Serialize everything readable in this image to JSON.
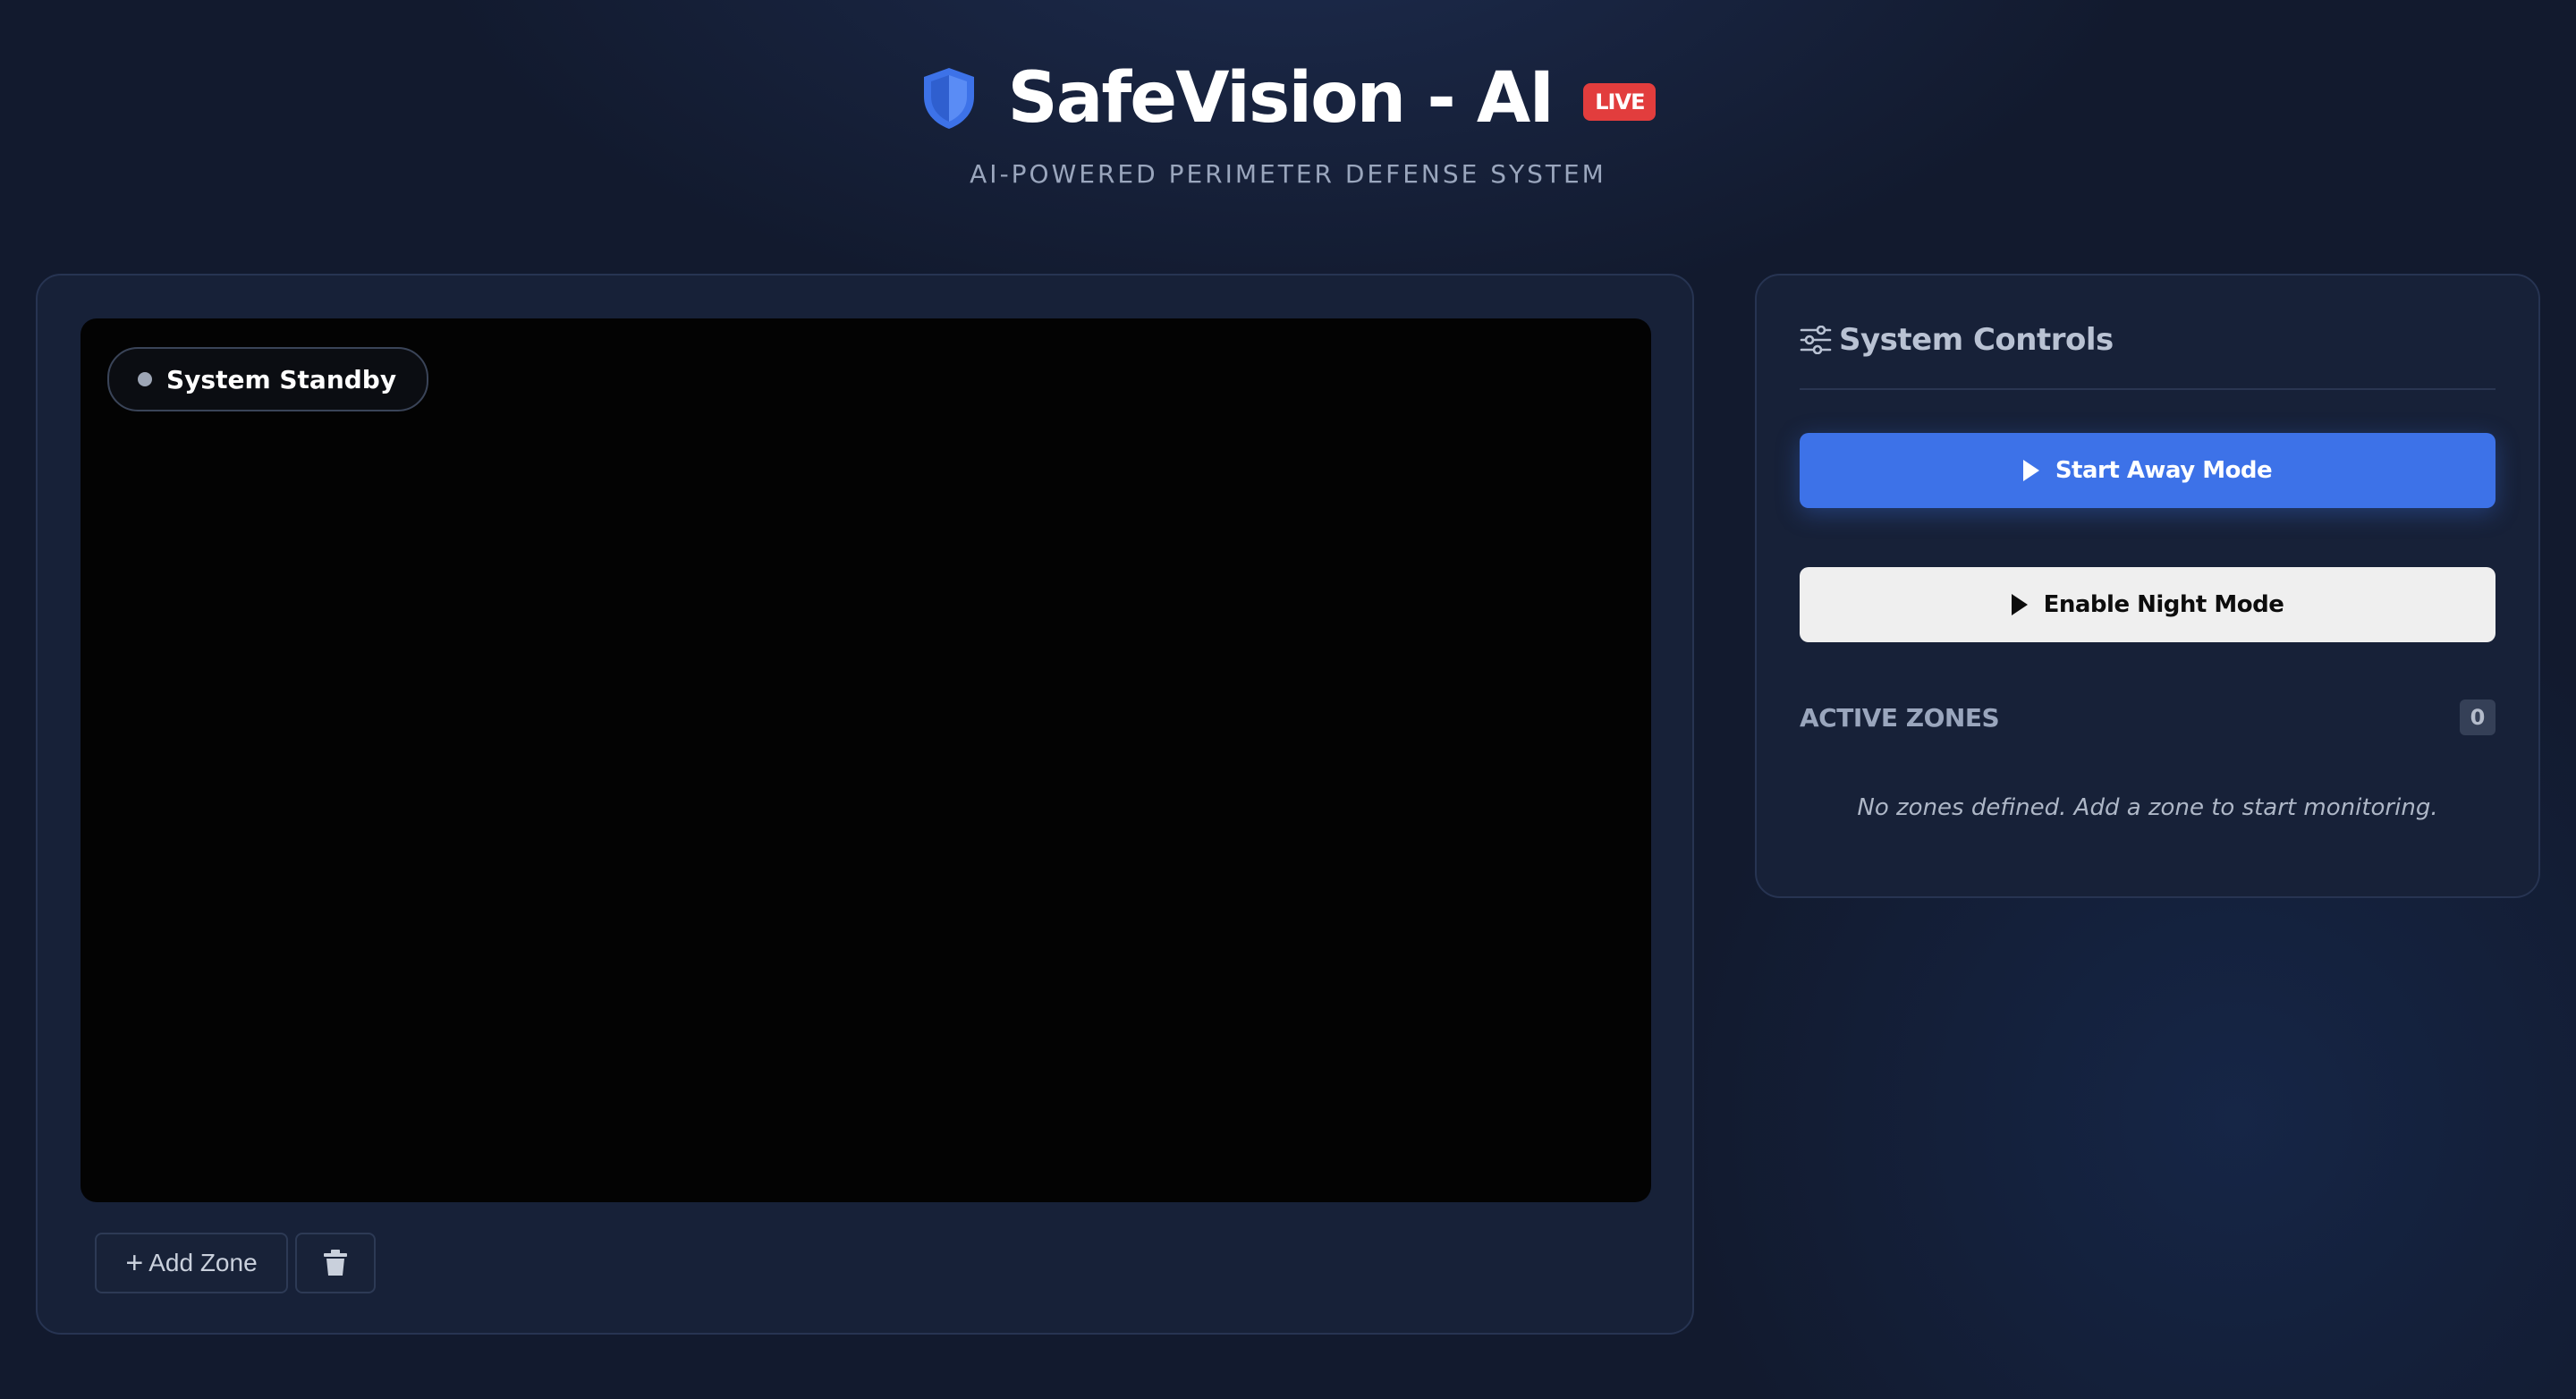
{
  "header": {
    "title": "SafeVision - AI",
    "live_badge": "LIVE",
    "subtitle": "AI-POWERED PERIMETER DEFENSE SYSTEM",
    "logo_icon": "shield-icon",
    "accent_color": "#3d72e8",
    "live_color": "#e23d3d"
  },
  "video": {
    "status_text": "System Standby",
    "status_dot_color": "#9ea6b6",
    "toolbar": {
      "add_zone_icon": "plus-icon",
      "add_zone_label": "Add Zone",
      "delete_icon": "trash-icon"
    }
  },
  "controls": {
    "icon": "sliders-icon",
    "title": "System Controls",
    "start_away_label": "Start Away Mode",
    "start_away_color": "#3d72e8",
    "night_mode_label": "Enable Night Mode",
    "button_icon": "play-icon",
    "zones": {
      "label": "ACTIVE ZONES",
      "count": "0",
      "empty_message": "No zones defined. Add a zone to start monitoring."
    }
  }
}
